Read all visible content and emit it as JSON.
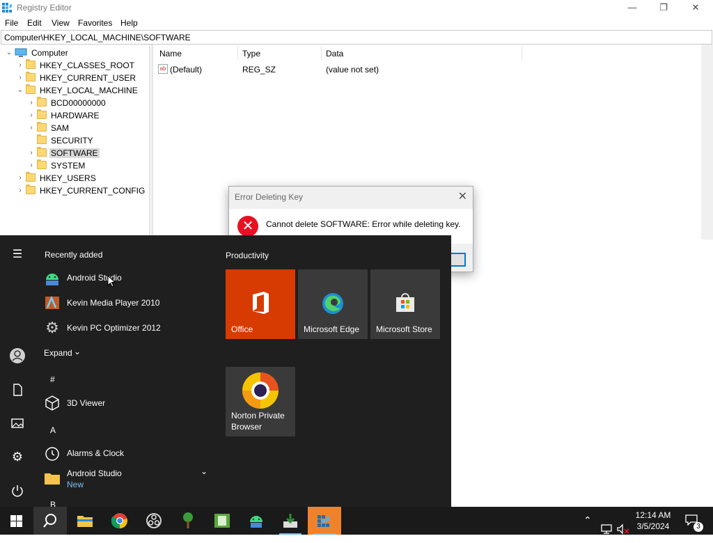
{
  "window": {
    "title": "Registry Editor",
    "controls": {
      "minimize": "—",
      "maximize": "❐",
      "close": "✕"
    }
  },
  "menu": [
    "File",
    "Edit",
    "View",
    "Favorites",
    "Help"
  ],
  "address": "Computer\\HKEY_LOCAL_MACHINE\\SOFTWARE",
  "tree": {
    "root": "Computer",
    "items": [
      {
        "label": "HKEY_CLASSES_ROOT",
        "chevron": "›"
      },
      {
        "label": "HKEY_CURRENT_USER",
        "chevron": "›"
      },
      {
        "label": "HKEY_LOCAL_MACHINE",
        "chevron": "⌄"
      },
      {
        "label": "BCD00000000",
        "chevron": "›"
      },
      {
        "label": "HARDWARE",
        "chevron": "›"
      },
      {
        "label": "SAM",
        "chevron": "›"
      },
      {
        "label": "SECURITY",
        "chevron": ""
      },
      {
        "label": "SOFTWARE",
        "chevron": "›"
      },
      {
        "label": "SYSTEM",
        "chevron": "›"
      },
      {
        "label": "HKEY_USERS",
        "chevron": "›"
      },
      {
        "label": "HKEY_CURRENT_CONFIG",
        "chevron": "›"
      }
    ]
  },
  "list": {
    "columns": [
      "Name",
      "Type",
      "Data"
    ],
    "rows": [
      {
        "name": "(Default)",
        "type": "REG_SZ",
        "data": "(value not set)"
      }
    ]
  },
  "dialog": {
    "title": "Error Deleting Key",
    "message": "Cannot delete SOFTWARE:  Error while deleting key.",
    "close": "✕",
    "error_glyph": "✕"
  },
  "start_menu": {
    "recently_added_title": "Recently added",
    "recent": [
      "Android Studio",
      "Kevin Media Player 2010",
      "Kevin PC Optimizer 2012"
    ],
    "expand_label": "Expand",
    "letters": [
      "#",
      "A",
      "B"
    ],
    "all_apps": [
      {
        "name": "3D Viewer"
      },
      {
        "name": "Alarms & Clock"
      },
      {
        "name": "Android Studio",
        "badge": "New"
      }
    ],
    "tiles_group": "Productivity",
    "tiles": [
      "Office",
      "Microsoft Edge",
      "Microsoft Store",
      "Norton Private\nBrowser"
    ]
  },
  "taskbar": {
    "clock_time": "12:14 AM",
    "clock_date": "3/5/2024",
    "notification_count": "3"
  },
  "colors": {
    "office_tile": "#d83b01",
    "tile_gray": "#3a3a3a",
    "start_bg": "#1f1f1f",
    "taskbar_bg": "#1a1a1a",
    "accent_highlight": "#f0822b"
  }
}
